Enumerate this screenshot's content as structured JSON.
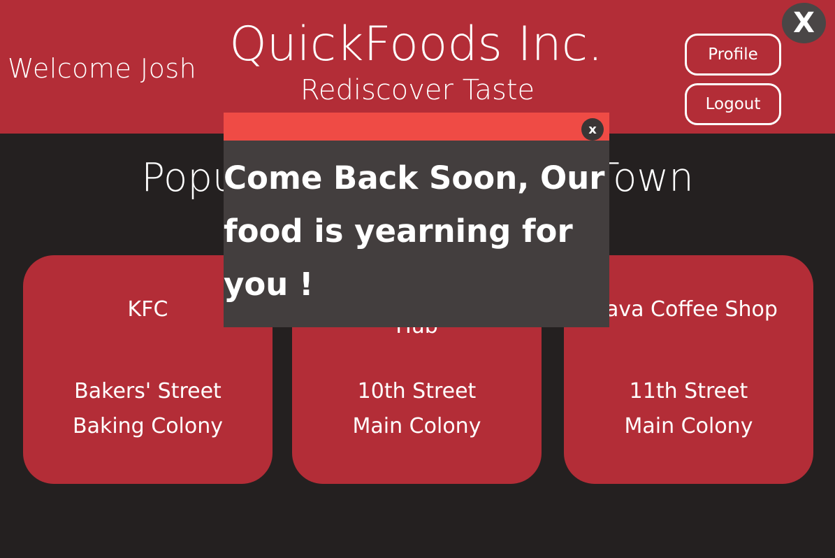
{
  "header": {
    "welcome": "Welcome Josh",
    "brand": "QuickFoods Inc.",
    "tagline": "Rediscover Taste",
    "profile_label": "Profile",
    "logout_label": "Logout",
    "close_label": "X"
  },
  "section": {
    "title": "Popular Restaurants in Town"
  },
  "restaurants": [
    {
      "name": "KFC",
      "street": "Bakers' Street",
      "colony": "Baking Colony"
    },
    {
      "name": "Pizza Hub",
      "street": "10th Street",
      "colony": "Main Colony"
    },
    {
      "name": "Java Coffee Shop",
      "street": "11th Street",
      "colony": "Main Colony"
    }
  ],
  "popup": {
    "close_label": "x",
    "message": "Come Back Soon, Our food is yearning for you !"
  },
  "colors": {
    "brand_red": "#b32d37",
    "background": "#242020",
    "popup_bar": "#ef4b45",
    "popup_body": "#433e3e"
  }
}
